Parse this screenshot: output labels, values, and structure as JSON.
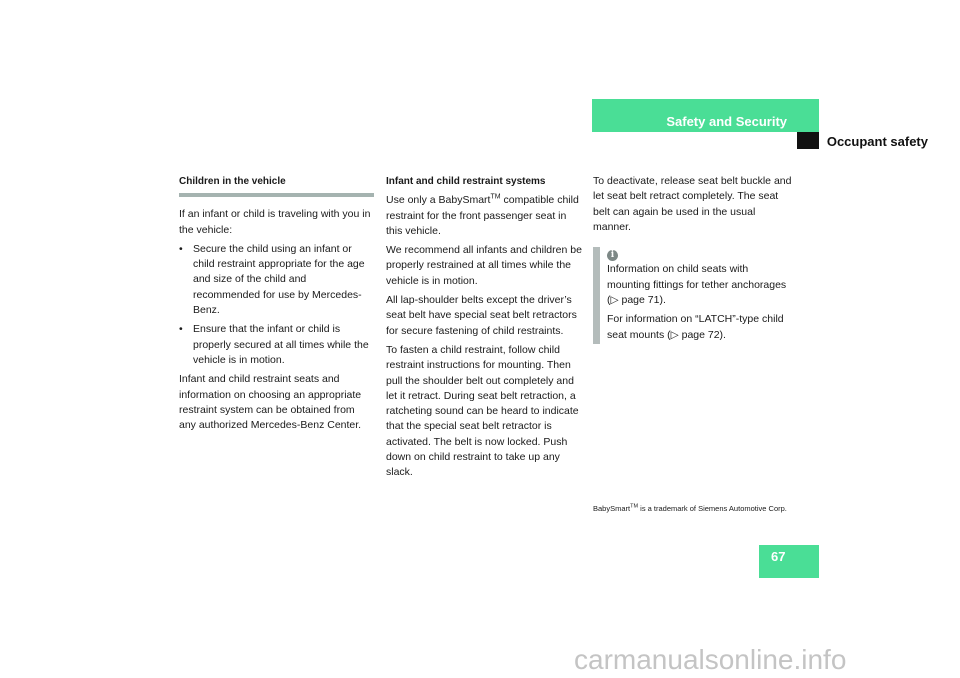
{
  "header": {
    "section": "Safety and Security",
    "subsection": "Occupant safety",
    "accent_color": "#4ade96"
  },
  "column1": {
    "heading": "Children in the vehicle",
    "intro": "If an infant or child is traveling with you in the vehicle:",
    "bullets": [
      "Secure the child using an infant or child restraint appropriate for the age and size of the child and recommended for use by Mercedes-Benz.",
      "Ensure that the infant or child is properly secured at all times while the vehicle is in motion."
    ],
    "bullet_glyph": "•",
    "closing": "Infant and child restraint seats and information on choosing an appropriate restraint system can be obtained from any authorized Mercedes-Benz Center."
  },
  "column2": {
    "heading": "Infant and child restraint systems",
    "p1_before": "Use only a BabySmart",
    "p1_sup": "TM",
    "p1_after": " compatible child restraint for the front passenger seat in this vehicle.",
    "p2": "We recommend all infants and children be properly restrained at all times while the vehicle is in motion.",
    "p3": "All lap-shoulder belts except the driver’s seat belt have special seat belt retractors for secure fastening of child restraints.",
    "p4": "To fasten a child restraint, follow child restraint instructions for mounting. Then pull the shoulder belt out completely and let it retract. During seat belt retraction, a ratcheting sound can be heard to indicate that the special seat belt retractor is activated. The belt is now locked. Push down on child restraint to take up any slack."
  },
  "column3": {
    "p1": "To deactivate, release seat belt buckle and let seat belt retract completely. The seat belt can again be used in the usual manner.",
    "info": {
      "icon": "i",
      "line1": "Information on child seats with mounting fittings for tether anchorages (▷ page 71).",
      "line2": "For information on “LATCH”-type child seat mounts (▷ page 72)."
    }
  },
  "footnote": {
    "before": "BabySmart",
    "sup": "TM",
    "after": " is a trademark of Siemens Automotive Corp."
  },
  "page_number": "67",
  "watermark": "carmanualsonline.info"
}
